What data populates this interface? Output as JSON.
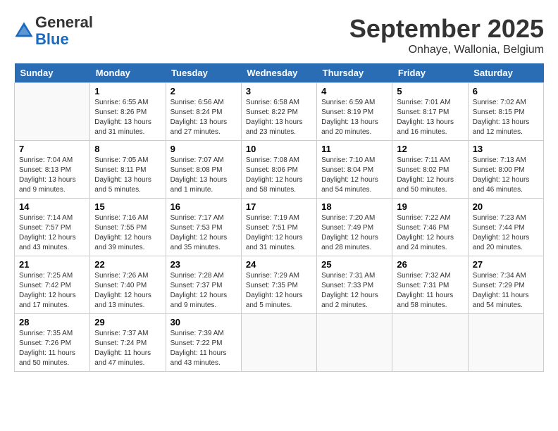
{
  "header": {
    "logo_line1": "General",
    "logo_line2": "Blue",
    "month": "September 2025",
    "location": "Onhaye, Wallonia, Belgium"
  },
  "weekdays": [
    "Sunday",
    "Monday",
    "Tuesday",
    "Wednesday",
    "Thursday",
    "Friday",
    "Saturday"
  ],
  "weeks": [
    [
      {
        "day": "",
        "info": ""
      },
      {
        "day": "1",
        "info": "Sunrise: 6:55 AM\nSunset: 8:26 PM\nDaylight: 13 hours\nand 31 minutes."
      },
      {
        "day": "2",
        "info": "Sunrise: 6:56 AM\nSunset: 8:24 PM\nDaylight: 13 hours\nand 27 minutes."
      },
      {
        "day": "3",
        "info": "Sunrise: 6:58 AM\nSunset: 8:22 PM\nDaylight: 13 hours\nand 23 minutes."
      },
      {
        "day": "4",
        "info": "Sunrise: 6:59 AM\nSunset: 8:19 PM\nDaylight: 13 hours\nand 20 minutes."
      },
      {
        "day": "5",
        "info": "Sunrise: 7:01 AM\nSunset: 8:17 PM\nDaylight: 13 hours\nand 16 minutes."
      },
      {
        "day": "6",
        "info": "Sunrise: 7:02 AM\nSunset: 8:15 PM\nDaylight: 13 hours\nand 12 minutes."
      }
    ],
    [
      {
        "day": "7",
        "info": "Sunrise: 7:04 AM\nSunset: 8:13 PM\nDaylight: 13 hours\nand 9 minutes."
      },
      {
        "day": "8",
        "info": "Sunrise: 7:05 AM\nSunset: 8:11 PM\nDaylight: 13 hours\nand 5 minutes."
      },
      {
        "day": "9",
        "info": "Sunrise: 7:07 AM\nSunset: 8:08 PM\nDaylight: 13 hours\nand 1 minute."
      },
      {
        "day": "10",
        "info": "Sunrise: 7:08 AM\nSunset: 8:06 PM\nDaylight: 12 hours\nand 58 minutes."
      },
      {
        "day": "11",
        "info": "Sunrise: 7:10 AM\nSunset: 8:04 PM\nDaylight: 12 hours\nand 54 minutes."
      },
      {
        "day": "12",
        "info": "Sunrise: 7:11 AM\nSunset: 8:02 PM\nDaylight: 12 hours\nand 50 minutes."
      },
      {
        "day": "13",
        "info": "Sunrise: 7:13 AM\nSunset: 8:00 PM\nDaylight: 12 hours\nand 46 minutes."
      }
    ],
    [
      {
        "day": "14",
        "info": "Sunrise: 7:14 AM\nSunset: 7:57 PM\nDaylight: 12 hours\nand 43 minutes."
      },
      {
        "day": "15",
        "info": "Sunrise: 7:16 AM\nSunset: 7:55 PM\nDaylight: 12 hours\nand 39 minutes."
      },
      {
        "day": "16",
        "info": "Sunrise: 7:17 AM\nSunset: 7:53 PM\nDaylight: 12 hours\nand 35 minutes."
      },
      {
        "day": "17",
        "info": "Sunrise: 7:19 AM\nSunset: 7:51 PM\nDaylight: 12 hours\nand 31 minutes."
      },
      {
        "day": "18",
        "info": "Sunrise: 7:20 AM\nSunset: 7:49 PM\nDaylight: 12 hours\nand 28 minutes."
      },
      {
        "day": "19",
        "info": "Sunrise: 7:22 AM\nSunset: 7:46 PM\nDaylight: 12 hours\nand 24 minutes."
      },
      {
        "day": "20",
        "info": "Sunrise: 7:23 AM\nSunset: 7:44 PM\nDaylight: 12 hours\nand 20 minutes."
      }
    ],
    [
      {
        "day": "21",
        "info": "Sunrise: 7:25 AM\nSunset: 7:42 PM\nDaylight: 12 hours\nand 17 minutes."
      },
      {
        "day": "22",
        "info": "Sunrise: 7:26 AM\nSunset: 7:40 PM\nDaylight: 12 hours\nand 13 minutes."
      },
      {
        "day": "23",
        "info": "Sunrise: 7:28 AM\nSunset: 7:37 PM\nDaylight: 12 hours\nand 9 minutes."
      },
      {
        "day": "24",
        "info": "Sunrise: 7:29 AM\nSunset: 7:35 PM\nDaylight: 12 hours\nand 5 minutes."
      },
      {
        "day": "25",
        "info": "Sunrise: 7:31 AM\nSunset: 7:33 PM\nDaylight: 12 hours\nand 2 minutes."
      },
      {
        "day": "26",
        "info": "Sunrise: 7:32 AM\nSunset: 7:31 PM\nDaylight: 11 hours\nand 58 minutes."
      },
      {
        "day": "27",
        "info": "Sunrise: 7:34 AM\nSunset: 7:29 PM\nDaylight: 11 hours\nand 54 minutes."
      }
    ],
    [
      {
        "day": "28",
        "info": "Sunrise: 7:35 AM\nSunset: 7:26 PM\nDaylight: 11 hours\nand 50 minutes."
      },
      {
        "day": "29",
        "info": "Sunrise: 7:37 AM\nSunset: 7:24 PM\nDaylight: 11 hours\nand 47 minutes."
      },
      {
        "day": "30",
        "info": "Sunrise: 7:39 AM\nSunset: 7:22 PM\nDaylight: 11 hours\nand 43 minutes."
      },
      {
        "day": "",
        "info": ""
      },
      {
        "day": "",
        "info": ""
      },
      {
        "day": "",
        "info": ""
      },
      {
        "day": "",
        "info": ""
      }
    ]
  ]
}
